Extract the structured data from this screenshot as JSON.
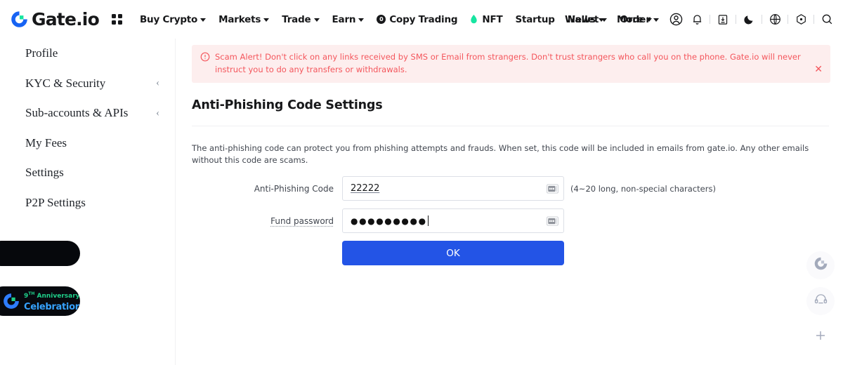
{
  "brand": {
    "name": "Gate.io",
    "logo_icon": "gate-logo-icon",
    "accent_blue": "#1763f3",
    "accent_green": "#17e5a1"
  },
  "header": {
    "apps_icon": "grid-apps-icon",
    "nav": [
      {
        "label": "Buy Crypto",
        "caret": true,
        "icon": null
      },
      {
        "label": "Markets",
        "caret": true,
        "icon": null
      },
      {
        "label": "Trade",
        "caret": true,
        "icon": null
      },
      {
        "label": "Earn",
        "caret": true,
        "icon": null
      },
      {
        "label": "Copy Trading",
        "caret": false,
        "icon": "copy-trading-badge-icon"
      },
      {
        "label": "NFT",
        "caret": false,
        "icon": "flame-icon"
      },
      {
        "label": "Startup",
        "caret": false,
        "icon": null
      },
      {
        "label": "News",
        "caret": true,
        "icon": null
      },
      {
        "label": "More",
        "caret": true,
        "icon": null
      }
    ],
    "right": {
      "wallet_label": "Wallet",
      "order_label": "Order",
      "icons": [
        "user-account-icon",
        "bell-notification-icon",
        "download-app-icon",
        "dark-mode-moon-icon",
        "language-globe-icon",
        "settings-gear-icon",
        "search-icon"
      ]
    }
  },
  "sidebar": {
    "items": [
      {
        "label": "Profile",
        "chevron": ""
      },
      {
        "label": "KYC & Security",
        "chevron": "‹"
      },
      {
        "label": "Sub-accounts & APIs",
        "chevron": "‹"
      },
      {
        "label": "My Fees",
        "chevron": ""
      },
      {
        "label": "Settings",
        "chevron": ""
      },
      {
        "label": "P2P Settings",
        "chevron": ""
      }
    ],
    "promo": {
      "anniversary_line1_num": "9",
      "anniversary_line1_sup": "TH",
      "anniversary_line1_word": "Anniversary",
      "anniversary_line2": "Celebration"
    }
  },
  "alert": {
    "icon": "warning-circle-icon",
    "text": "Scam Alert! Don't click on any links received by SMS or Email from strangers. Don't trust strangers who call you on the phone. Gate.io will never instruct you to do any transfers or withdrawals.",
    "close_icon": "close-icon",
    "color": "#f4565c",
    "background": "#fdeeee"
  },
  "main": {
    "page_title": "Anti-Phishing Code Settings",
    "description": "The anti-phishing code can protect you from phishing attempts and frauds. When set, this code will be included in emails from gate.io. Any other emails without this code are scams.",
    "form": {
      "code_field": {
        "label": "Anti-Phishing Code",
        "value": "22222",
        "placeholder": "",
        "hint": "(4~20 long, non-special characters)",
        "trailing_icon": "password-manager-icon"
      },
      "password_field": {
        "label": "Fund password",
        "value": "●●●●●●●●●",
        "placeholder": "",
        "trailing_icon": "password-manager-icon"
      },
      "submit_label": "OK",
      "submit_color": "#2354e6"
    }
  },
  "rail": {
    "buttons": [
      {
        "icon": "gate-logo-icon",
        "label": ""
      },
      {
        "icon": "headset-support-icon",
        "label": ""
      },
      {
        "icon": "plus-icon",
        "label": ""
      }
    ]
  }
}
